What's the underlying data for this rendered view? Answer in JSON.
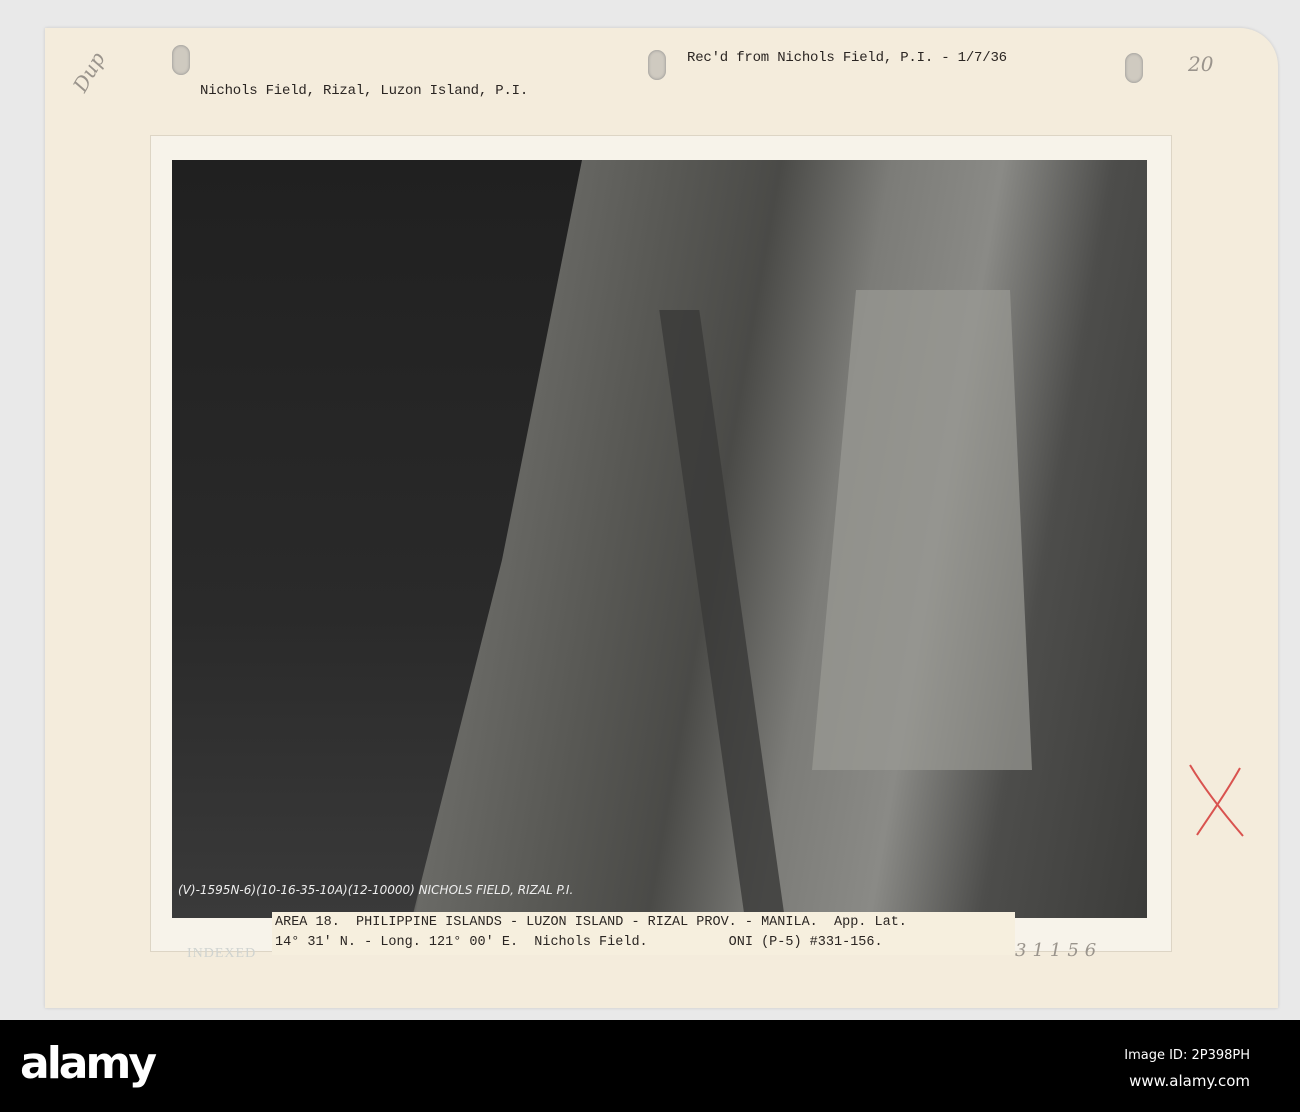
{
  "card": {
    "header_left": "Nichols Field, Rizal, Luzon Island, P.I.",
    "header_right": "Rec'd from Nichols Field, P.I. - 1/7/36",
    "handwritten_topleft": "Dup",
    "handwritten_topright": "20",
    "handwritten_number": "31156",
    "stamp_indexed": "INDEXED"
  },
  "photo": {
    "negative_annotation": "(V)-1595N-6)(10-16-35-10A)(12-10000)  NICHOLS FIELD, RIZAL P.I."
  },
  "caption": {
    "line1": "AREA 18.  PHILIPPINE ISLANDS - LUZON ISLAND - RIZAL PROV. - MANILA.  App. Lat.",
    "line2": "14° 31' N. - Long. 121° 00' E.  Nichols Field.          ONI (P-5) #331-156."
  },
  "banner": {
    "logo": "alamy",
    "image_id": "Image ID: 2P398PH",
    "url": "www.alamy.com"
  },
  "colors": {
    "card": "#f4ecdc",
    "mark_red": "#d9534f"
  }
}
